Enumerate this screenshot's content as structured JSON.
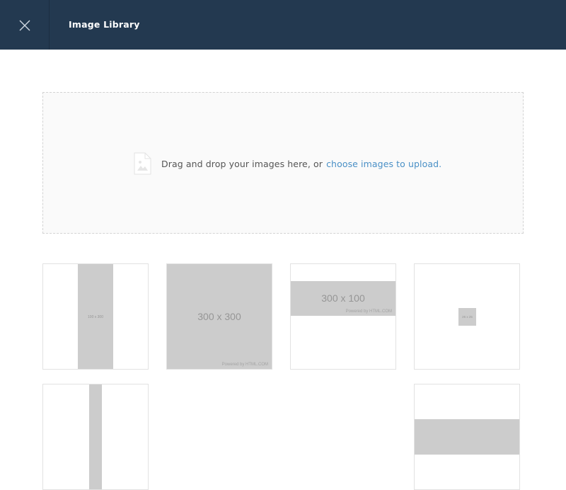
{
  "header": {
    "title": "Image Library",
    "close_icon": "close-icon"
  },
  "dropzone": {
    "icon": "image-file-icon",
    "text": "Drag and drop your images here, or ",
    "link_text": "choose images to upload",
    "link_suffix": "."
  },
  "images": [
    {
      "label": "100 x 300"
    },
    {
      "label": "300 x 300",
      "powered": "Powered by HTML.COM"
    },
    {
      "label": "300 x 100",
      "powered": "Powered by HTML.COM"
    },
    {
      "label": "25 x 25"
    },
    {
      "label": ""
    },
    {
      "label": ""
    }
  ],
  "colors": {
    "header_bg": "#233950",
    "link": "#4a90c6",
    "placeholder": "#cccccc"
  }
}
